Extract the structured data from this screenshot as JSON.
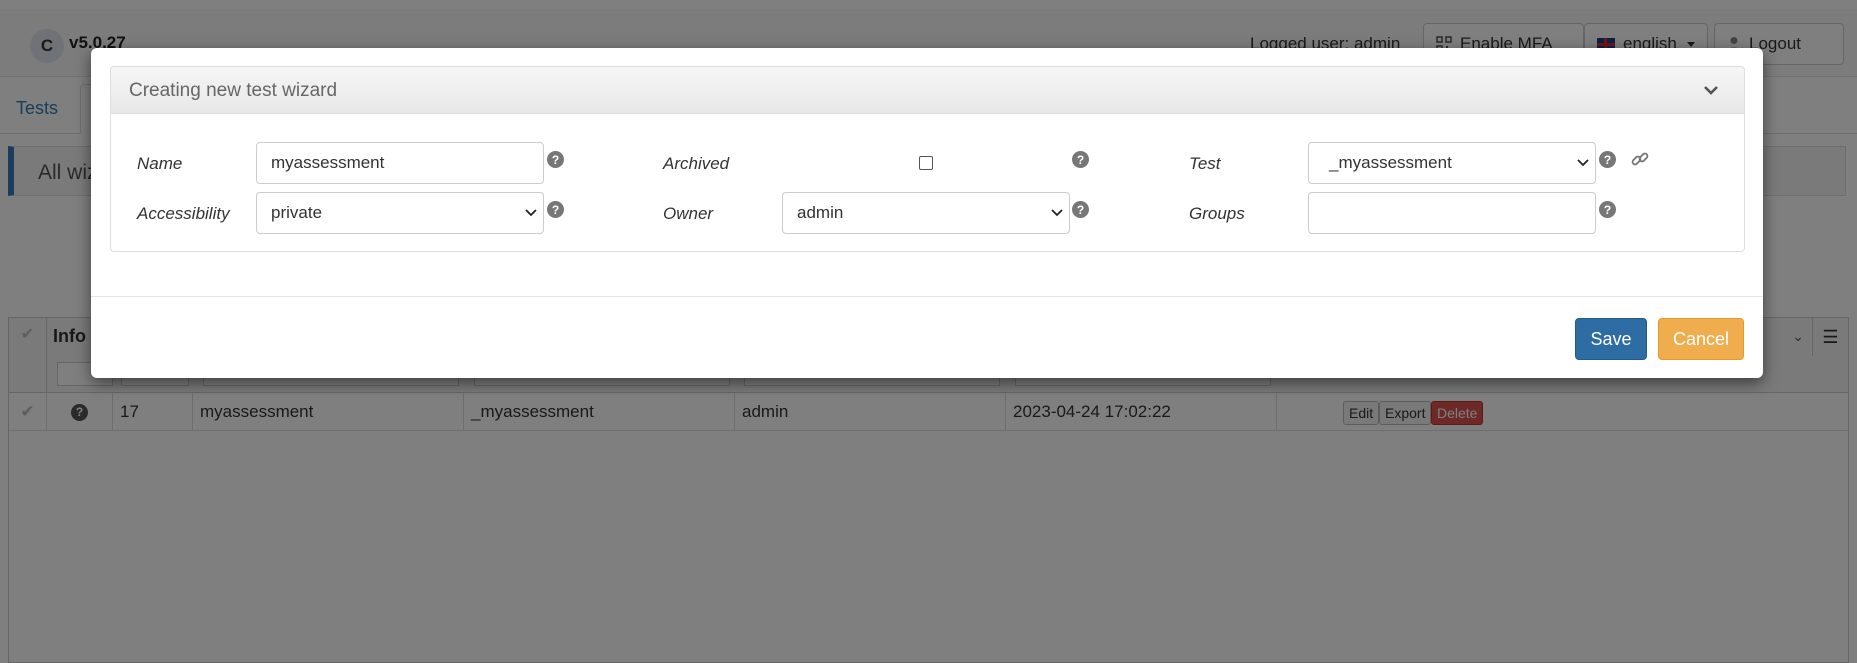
{
  "header": {
    "logo_letter": "C",
    "version": "v5.0.27",
    "logged_user": "Logged user: admin",
    "mfa_button": "Enable MFA",
    "language": "english",
    "logout_button": "Logout"
  },
  "tabs": {
    "first": "Tests"
  },
  "panel": {
    "title": "All wiz"
  },
  "grid": {
    "header_label": "Info",
    "row": {
      "id": "17",
      "name": "myassessment",
      "test": "_myassessment",
      "owner": "admin",
      "updated": "2023-04-24 17:02:22",
      "actions": [
        "Edit",
        "Export",
        "Delete"
      ]
    }
  },
  "modal": {
    "title": "Creating new test wizard",
    "fields": {
      "name_label": "Name",
      "name_value": "myassessment",
      "archived_label": "Archived",
      "archived_checked": false,
      "test_label": "Test",
      "test_value": "_myassessment",
      "accessibility_label": "Accessibility",
      "accessibility_value": "private",
      "owner_label": "Owner",
      "owner_value": "admin",
      "groups_label": "Groups",
      "groups_value": ""
    },
    "save_label": "Save",
    "cancel_label": "Cancel"
  },
  "colors": {
    "primary": "#2e6da4",
    "warning": "#f0ad4e",
    "danger": "#d9534f",
    "link": "#337ab7"
  }
}
